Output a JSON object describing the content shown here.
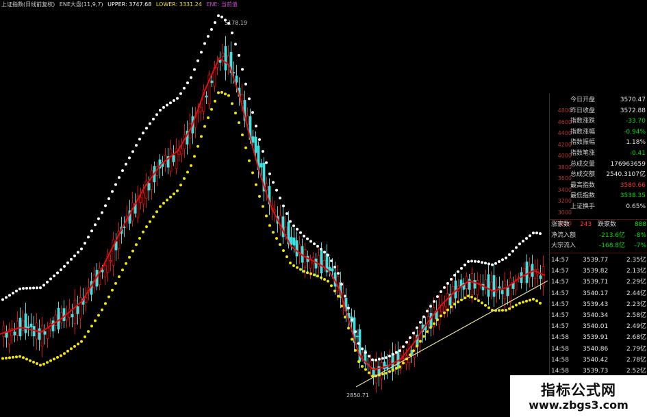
{
  "title_bar": {
    "name": "上证指数(日线前复权)",
    "indicator": "ENE大盘(11,9,7)",
    "upper": "UPPER: 3747.68",
    "lower": "LOWER: 3331.24",
    "extra": "ENE: 当前值"
  },
  "chart_annotations": {
    "high_label": "5178.19",
    "low_label": "2850.71"
  },
  "colors": {
    "upper_band": "#ffffff",
    "lower_band": "#f2e600",
    "middle_line": "#e01010",
    "up_candle": "#e01010",
    "down_candle": "#3fe0e0",
    "trend_line": "#e8e0a0"
  },
  "quote_panel": {
    "axis_labels": [
      "4800",
      "4600",
      "4400",
      "4200",
      "4000",
      "3800",
      "3600",
      "3400",
      "3200",
      "3000",
      "2800"
    ],
    "rows": [
      {
        "label": "今日开盘",
        "value": "3570.47",
        "color": "#e8e8e8"
      },
      {
        "label": "昨日收盘",
        "value": "3572.88",
        "color": "#e8e8e8"
      },
      {
        "label": "指数涨跌",
        "value": "-33.70",
        "color": "#00e000"
      },
      {
        "label": "指数涨幅",
        "value": "-0.94%",
        "color": "#00e000"
      },
      {
        "label": "指数振幅",
        "value": "1.18%",
        "color": "#e8e8e8"
      },
      {
        "label": "指数笔涨",
        "value": "-0.41",
        "color": "#00e000"
      },
      {
        "label": "总成交量",
        "value": "176963659",
        "color": "#e8e8e8"
      },
      {
        "label": "总成交额",
        "value": "2540.3107亿",
        "color": "#e8e8e8"
      },
      {
        "label": "最高指数",
        "value": "3580.66",
        "color": "#ff3030"
      },
      {
        "label": "最低指数",
        "value": "3538.35",
        "color": "#00e000"
      },
      {
        "label": "上证换手",
        "value": "0.65%",
        "color": "#e8e8e8"
      }
    ],
    "updown": {
      "up_label": "涨家数",
      "up_value": "243",
      "down_label": "跌家数",
      "down_value": "888"
    },
    "flows": [
      {
        "label": "净流入额",
        "value": "-213.6亿",
        "pct": "-8%"
      },
      {
        "label": "大宗流入",
        "value": "-168.8亿",
        "pct": "-7%"
      }
    ],
    "ticks": [
      {
        "time": "14:57",
        "price": "3539.77",
        "vol": "2.35亿",
        "color": "#00e000"
      },
      {
        "time": "14:57",
        "price": "3539.82",
        "vol": "2.13亿",
        "color": "#00e000"
      },
      {
        "time": "14:57",
        "price": "3539.71",
        "vol": "2.29亿",
        "color": "#00e000"
      },
      {
        "time": "14:57",
        "price": "3540.17",
        "vol": "2.44亿",
        "color": "#00e000"
      },
      {
        "time": "14:57",
        "price": "3539.43",
        "vol": "2.23亿",
        "color": "#00e000"
      },
      {
        "time": "14:57",
        "price": "3540.34",
        "vol": "2.58亿",
        "color": "#00e000"
      },
      {
        "time": "14:57",
        "price": "3540.01",
        "vol": "2.49亿",
        "color": "#00e000"
      },
      {
        "time": "14:58",
        "price": "3539.91",
        "vol": "2.68亿",
        "color": "#00e000"
      },
      {
        "time": "14:58",
        "price": "3540.86",
        "vol": "2.79亿",
        "color": "#00e000"
      },
      {
        "time": "14:58",
        "price": "3540.42",
        "vol": "2.78亿",
        "color": "#00e000"
      },
      {
        "time": "14:58",
        "price": "3539.73",
        "vol": "2.52亿",
        "color": "#00e000"
      }
    ]
  },
  "watermark": {
    "title": "指标公式网",
    "url": "www.zbgs3.com"
  }
}
